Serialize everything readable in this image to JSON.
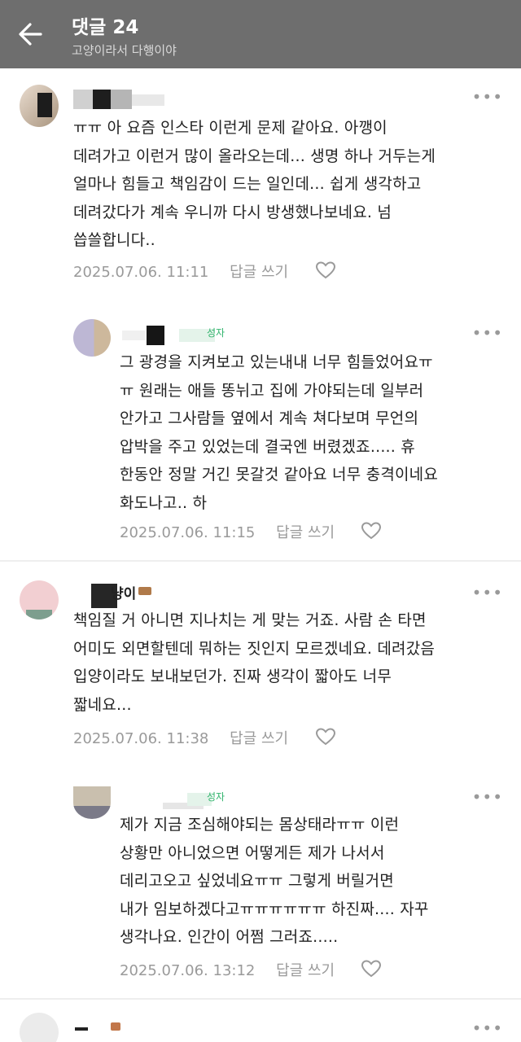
{
  "header": {
    "title": "댓글 24",
    "subtitle": "고양이라서 다행이야"
  },
  "comments": [
    {
      "lines": [
        "ㅠㅠ 아 요즘 인스타 이런게 문제 같아요. 아깽이",
        "데려가고 이런거 많이 올라오는데... 생명 하나 거두는게",
        "얼마나 힘들고 책임감이 드는 일인데... 쉽게 생각하고",
        "데려갔다가 계속 우니까 다시 방생했나보네요. 넘",
        "씁쓸합니다.."
      ],
      "timestamp": "2025.07.06. 11:11",
      "reply_label": "답글 쓰기"
    },
    {
      "author_tag": "성자",
      "lines": [
        "그 광경을 지켜보고 있는내내 너무 힘들었어요ㅠ",
        "ㅠ 원래는 애들 똥뉘고 집에 가야되는데 일부러",
        "안가고 그사람들 옆에서 계속 쳐다보며 무언의",
        "압박을 주고 있었는데 결국엔 버렸겠죠..... 휴",
        "한동안 정말 거긴 못갈것 같아요 너무 충격이네요",
        "화도나고.. 하"
      ],
      "timestamp": "2025.07.06. 11:15",
      "reply_label": "답글 쓰기"
    },
    {
      "author_name": "냥이",
      "lines": [
        "책임질 거 아니면 지나치는 게 맞는 거죠. 사람 손 타면",
        "어미도 외면할텐데 뭐하는 짓인지 모르겠네요. 데려갔음",
        "입양이라도 보내보던가. 진짜 생각이 짧아도 너무",
        "짧네요..."
      ],
      "timestamp": "2025.07.06. 11:38",
      "reply_label": "답글 쓰기"
    },
    {
      "author_tag": "성자",
      "lines": [
        "제가 지금 조심해야되는 몸상태라ㅠㅠ 이런",
        "상황만 아니었으면 어떻게든 제가 나서서",
        "데리고오고 싶었네요ㅠㅠ 그렇게 버릴거면",
        "내가 임보하겠다고ㅠㅠㅠㅠㅠㅠ 하진짜.... 자꾸",
        "생각나요. 인간이 어쩜 그러죠....."
      ],
      "timestamp": "2025.07.06. 13:12",
      "reply_label": "답글 쓰기"
    }
  ],
  "icons": {
    "back": "arrow-left",
    "more": "more-dots",
    "like": "heart-outline"
  },
  "colors": {
    "header_bg": "#6e6e6e",
    "meta_text": "#9a9a9a",
    "writer_tag": "#2fb36b"
  }
}
